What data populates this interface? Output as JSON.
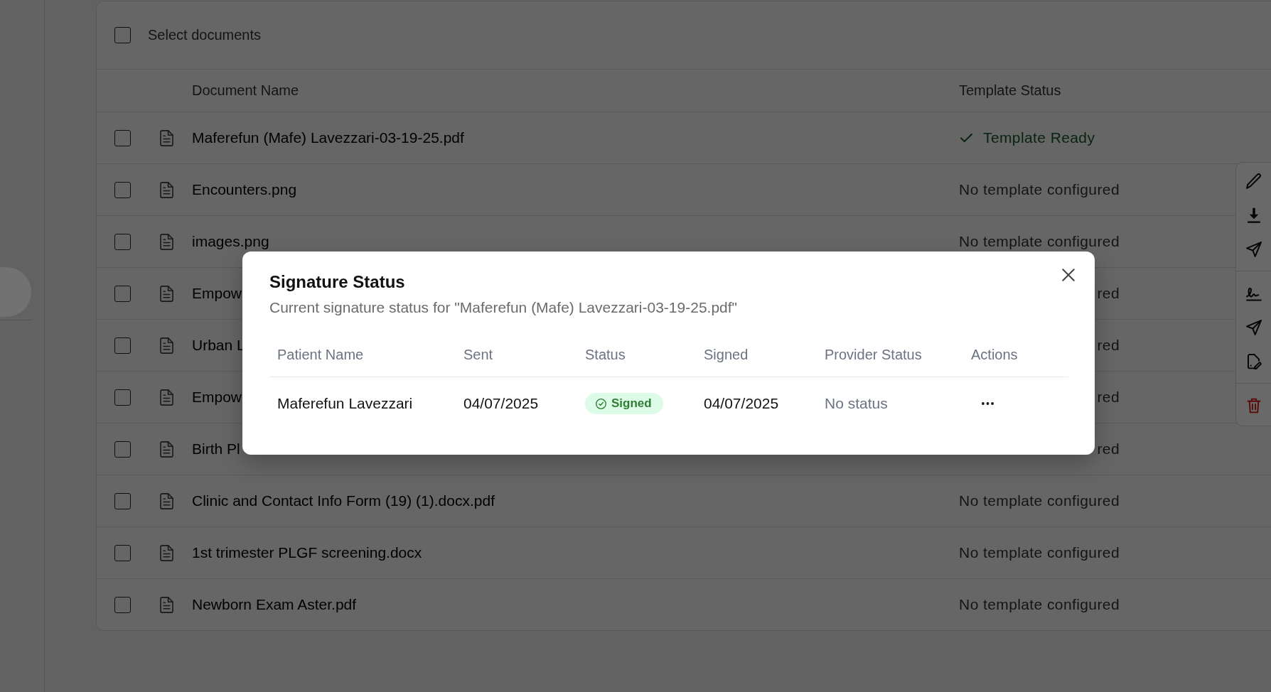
{
  "documents": {
    "select_all": {
      "label": "Select documents",
      "checked": false
    },
    "columns": [
      "Document Name",
      "Template Status"
    ],
    "rows": [
      {
        "name": "Maferefun (Mafe) Lavezzari-03-19-25.pdf",
        "checked": false,
        "template_status": "Template Ready",
        "template_ready": true
      },
      {
        "name": "Encounters.png",
        "checked": false,
        "template_status": "No template configured",
        "template_ready": false
      },
      {
        "name": "images.png",
        "checked": false,
        "template_status": "No template configured",
        "template_ready": false
      },
      {
        "name": "Empow",
        "checked": false,
        "template_status": "red",
        "template_ready": false
      },
      {
        "name": "Urban L",
        "checked": false,
        "template_status": "red",
        "template_ready": false
      },
      {
        "name": "Empow",
        "checked": false,
        "template_status": "red",
        "template_ready": false
      },
      {
        "name": "Birth Pl",
        "checked": false,
        "template_status": "red",
        "template_ready": false
      },
      {
        "name": "Clinic and Contact Info Form (19) (1).docx.pdf",
        "checked": false,
        "template_status": "No template configured",
        "template_ready": false
      },
      {
        "name": "1st trimester PLGF screening.docx",
        "checked": false,
        "template_status": "No template configured",
        "template_ready": false
      },
      {
        "name": "Newborn Exam Aster.pdf",
        "checked": false,
        "template_status": "No template configured",
        "template_ready": false
      }
    ]
  },
  "dialog": {
    "title": "Signature Status",
    "subtitle": "Current signature status for \"Maferefun (Mafe) Lavezzari-03-19-25.pdf\"",
    "columns": [
      "Patient Name",
      "Sent",
      "Status",
      "Signed",
      "Provider Status",
      "Actions"
    ],
    "rows": [
      {
        "patient_name": "Maferefun Lavezzari",
        "sent": "04/07/2025",
        "status": {
          "label": "Signed",
          "kind": "signed"
        },
        "signed": "04/07/2025",
        "provider_status": "No status"
      }
    ]
  }
}
